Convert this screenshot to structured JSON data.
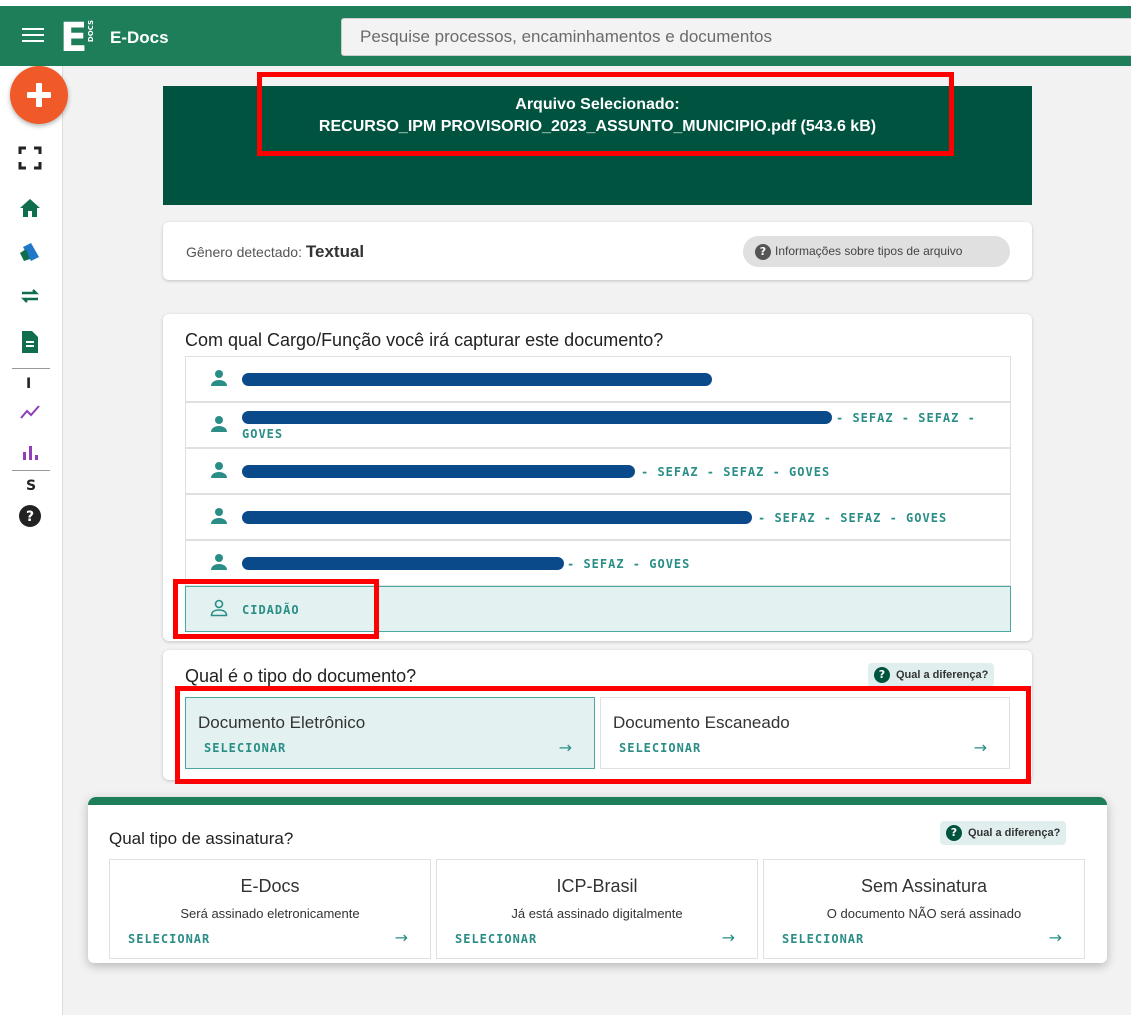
{
  "app": {
    "title": "E-Docs",
    "logo_letter": "E",
    "logo_sub": "DOCS",
    "search_placeholder": "Pesquise processos, encaminhamentos e documentos"
  },
  "sidebar": {
    "letters": [
      "I",
      "S"
    ],
    "icons": [
      "plus-icon",
      "fullscreen-icon",
      "home-icon",
      "tags-icon",
      "swap-icon",
      "document-icon",
      "trend-icon",
      "bar-chart-icon",
      "help-icon"
    ]
  },
  "file": {
    "heading": "Arquivo Selecionado:",
    "name": "RECURSO_IPM PROVISORIO_2023_ASSUNTO_MUNICIPIO.pdf (543.6 kB)"
  },
  "genre": {
    "label": "Gênero detectado: ",
    "value": "Textual",
    "info_button": "Informações sobre tipos de arquivo"
  },
  "roles": {
    "question": "Com qual Cargo/Função você irá capturar este documento?",
    "items": [
      {
        "suffix": ""
      },
      {
        "suffix": "- SEFAZ - SEFAZ -",
        "suffix2": "GOVES"
      },
      {
        "suffix": "- SEFAZ - SEFAZ - GOVES"
      },
      {
        "suffix": "- SEFAZ - SEFAZ - GOVES"
      },
      {
        "suffix": "- SEFAZ - GOVES"
      },
      {
        "label": "CIDADÃO"
      }
    ]
  },
  "doc_type": {
    "question": "Qual é o tipo do documento?",
    "diff_label": "Qual a diferença?",
    "options": [
      {
        "title": "Documento Eletrônico",
        "action": "SELECIONAR"
      },
      {
        "title": "Documento Escaneado",
        "action": "SELECIONAR"
      }
    ]
  },
  "signature": {
    "question": "Qual tipo de assinatura?",
    "diff_label": "Qual a diferença?",
    "options": [
      {
        "title": "E-Docs",
        "desc": "Será assinado eletronicamente",
        "action": "SELECIONAR"
      },
      {
        "title": "ICP-Brasil",
        "desc": "Já está assinado digitalmente",
        "action": "SELECIONAR"
      },
      {
        "title": "Sem Assinatura",
        "desc": "O documento NÃO será assinado",
        "action": "SELECIONAR"
      }
    ]
  },
  "colors": {
    "primary": "#1e7e5a",
    "banner": "#00533f",
    "accent": "#2a8e86",
    "fab": "#f05a28",
    "highlight": "#ff0000",
    "redaction": "#0a4a8a"
  }
}
